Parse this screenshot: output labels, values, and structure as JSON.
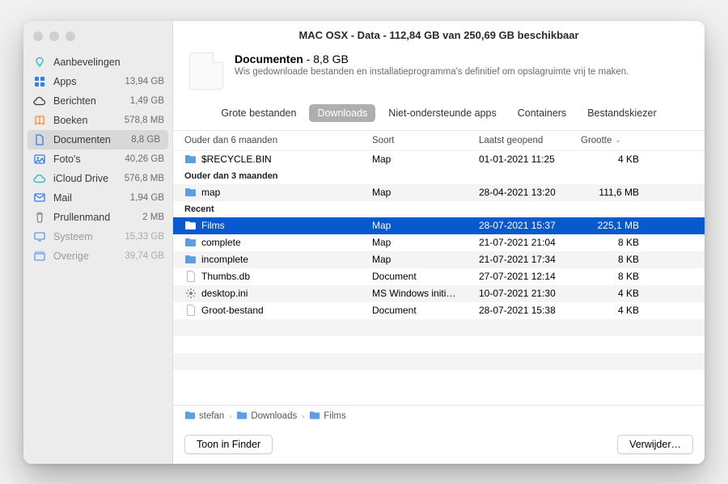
{
  "window_title": "MAC OSX - Data - 112,84 GB van 250,69 GB beschikbaar",
  "sidebar": {
    "items": [
      {
        "icon": "bulb",
        "label": "Aanbevelingen",
        "size": "",
        "color": "#1fb8c4"
      },
      {
        "icon": "apps",
        "label": "Apps",
        "size": "13,94 GB",
        "color": "#2f7ef4"
      },
      {
        "icon": "cloud",
        "label": "Berichten",
        "size": "1,49 GB",
        "color": "#3b3b3b"
      },
      {
        "icon": "book",
        "label": "Boeken",
        "size": "578,8 MB",
        "color": "#ff8a22"
      },
      {
        "icon": "doc",
        "label": "Documenten",
        "size": "8,8 GB",
        "color": "#2f7ef4",
        "selected": true
      },
      {
        "icon": "photo",
        "label": "Foto's",
        "size": "40,26 GB",
        "color": "#2f7ef4"
      },
      {
        "icon": "icloud",
        "label": "iCloud Drive",
        "size": "576,8 MB",
        "color": "#1fb8c4"
      },
      {
        "icon": "mail",
        "label": "Mail",
        "size": "1,94 GB",
        "color": "#2f7ef4"
      },
      {
        "icon": "trash",
        "label": "Prullenmand",
        "size": "2 MB",
        "color": "#8a8a8a"
      },
      {
        "icon": "sys",
        "label": "Systeem",
        "size": "15,33 GB",
        "dim": true
      },
      {
        "icon": "other",
        "label": "Overige",
        "size": "39,74 GB",
        "dim": true
      }
    ]
  },
  "summary": {
    "title": "Documenten",
    "size": "8,8 GB",
    "desc": "Wis gedownloade bestanden en installatieprogramma's definitief om opslagruimte vrij te maken."
  },
  "tabs": [
    {
      "label": "Grote bestanden"
    },
    {
      "label": "Downloads",
      "active": true
    },
    {
      "label": "Niet-ondersteunde apps"
    },
    {
      "label": "Containers"
    },
    {
      "label": "Bestandskiezer"
    }
  ],
  "columns": {
    "name": "Ouder dan 6 maanden",
    "kind": "Soort",
    "opened": "Laatst geopend",
    "size": "Grootte"
  },
  "groups": [
    {
      "title": "Ouder dan 6 maanden",
      "rows": [
        {
          "icon": "folder",
          "name": "$RECYCLE.BIN",
          "kind": "Map",
          "opened": "01-01-2021 11:25",
          "size": "4 KB"
        }
      ]
    },
    {
      "title": "Ouder dan 3 maanden",
      "rows": [
        {
          "icon": "folder",
          "name": "map",
          "kind": "Map",
          "opened": "28-04-2021 13:20",
          "size": "111,6 MB",
          "stripe": true
        }
      ]
    },
    {
      "title": "Recent",
      "rows": [
        {
          "icon": "folder",
          "name": "Films",
          "kind": "Map",
          "opened": "28-07-2021 15:37",
          "size": "225,1 MB",
          "selected": true
        },
        {
          "icon": "folder",
          "name": "complete",
          "kind": "Map",
          "opened": "21-07-2021 21:04",
          "size": "8 KB"
        },
        {
          "icon": "folder",
          "name": "incomplete",
          "kind": "Map",
          "opened": "21-07-2021 17:34",
          "size": "8 KB",
          "stripe": true
        },
        {
          "icon": "file",
          "name": "Thumbs.db",
          "kind": "Document",
          "opened": "27-07-2021 12:14",
          "size": "8 KB"
        },
        {
          "icon": "gear",
          "name": "desktop.ini",
          "kind": "MS Windows initi…",
          "opened": "10-07-2021 21:30",
          "size": "4 KB",
          "stripe": true
        },
        {
          "icon": "file",
          "name": "Groot-bestand",
          "kind": "Document",
          "opened": "28-07-2021 15:38",
          "size": "4 KB"
        }
      ]
    }
  ],
  "breadcrumb": [
    {
      "label": "stefan"
    },
    {
      "label": "Downloads"
    },
    {
      "label": "Films"
    }
  ],
  "footer": {
    "show_in_finder": "Toon in Finder",
    "delete": "Verwijder…"
  }
}
